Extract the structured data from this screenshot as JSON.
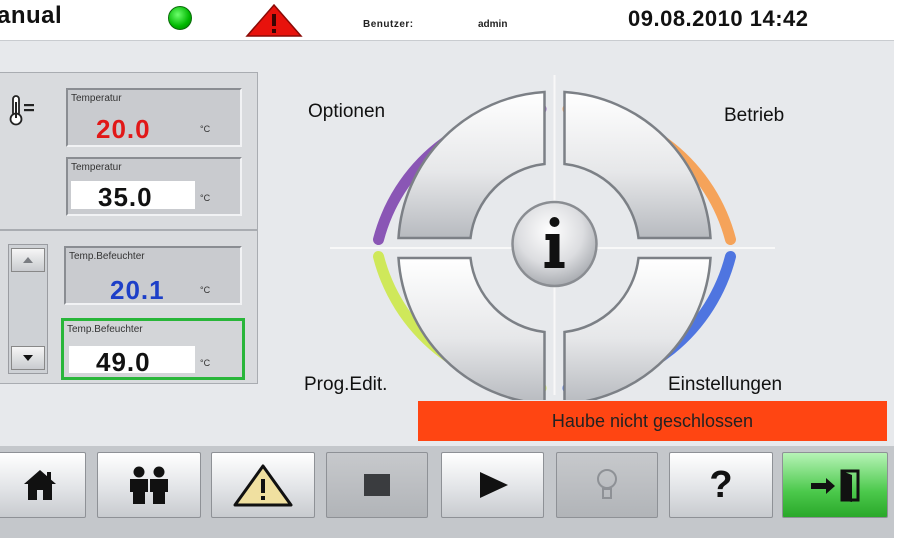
{
  "header": {
    "mode": "anual",
    "user_label": "Benutzer:",
    "user_name": "admin",
    "datetime": "09.08.2010 14:42"
  },
  "status": {
    "led_color": "#00c000",
    "warning_color": "#e8120c"
  },
  "panel_temperature": {
    "actual": {
      "label": "Temperatur",
      "value": "20.0",
      "unit": "°C",
      "color": "#e11818"
    },
    "setpoint": {
      "label": "Temperatur",
      "value": "35.0",
      "unit": "°C"
    }
  },
  "panel_humidifier": {
    "actual": {
      "label": "Temp.Befeuchter",
      "value": "20.1",
      "unit": "°C",
      "color": "#1d3fc8"
    },
    "setpoint": {
      "label": "Temp.Befeuchter",
      "value": "49.0",
      "unit": "°C"
    }
  },
  "menu": {
    "options": "Optionen",
    "operation": "Betrieb",
    "program_edit": "Prog.Edit.",
    "settings": "Einstellungen",
    "info_icon": "info-icon"
  },
  "alarm": {
    "message": "Haube nicht geschlossen",
    "color": "#ff4512"
  },
  "nav": {
    "buttons": [
      "home-icon",
      "users-icon",
      "warning-icon",
      "stop-icon",
      "play-icon",
      "bulb-icon",
      "help-icon",
      "exit-icon"
    ],
    "help_glyph": "?"
  }
}
